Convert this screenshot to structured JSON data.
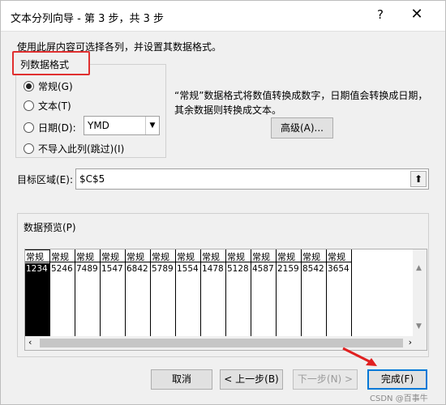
{
  "window": {
    "title": "文本分列向导 - 第 3 步，共 3 步",
    "help_label": "?",
    "close_label": "✕"
  },
  "instruction": "使用此屏内容可选择各列，并设置其数据格式。",
  "column_format": {
    "group_title": "列数据格式",
    "options": [
      {
        "label": "常规(G)",
        "checked": true
      },
      {
        "label": "文本(T)",
        "checked": false
      },
      {
        "label": "日期(D):",
        "checked": false
      },
      {
        "label": "不导入此列(跳过)(I)",
        "checked": false
      }
    ],
    "date_format_value": "YMD"
  },
  "description": "“常规”数据格式将数值转换成数字，日期值会转换成日期，其余数据则转换成文本。",
  "advanced_button": "高级(A)...",
  "destination": {
    "label": "目标区域(E):",
    "value": "$C$5",
    "collapse_icon": "⬆"
  },
  "preview": {
    "title": "数据预览(P)",
    "headers": [
      "常规",
      "常规",
      "常规",
      "常规",
      "常规",
      "常规",
      "常规",
      "常规",
      "常规",
      "常规",
      "常规",
      "常规",
      "常规"
    ],
    "row": [
      "1234",
      "5246",
      "7489",
      "1547",
      "6842",
      "5789",
      "1554",
      "1478",
      "5128",
      "4587",
      "2159",
      "8542",
      "3654"
    ],
    "selected_column": 0
  },
  "buttons": {
    "cancel": "取消",
    "back": "< 上一步(B)",
    "next": "下一步(N) >",
    "finish": "完成(F)"
  },
  "watermark": "CSDN @百事牛",
  "colors": {
    "highlight_box": "#e03030",
    "annotation_arrow": "#e02020",
    "primary_border": "#0078d7"
  }
}
